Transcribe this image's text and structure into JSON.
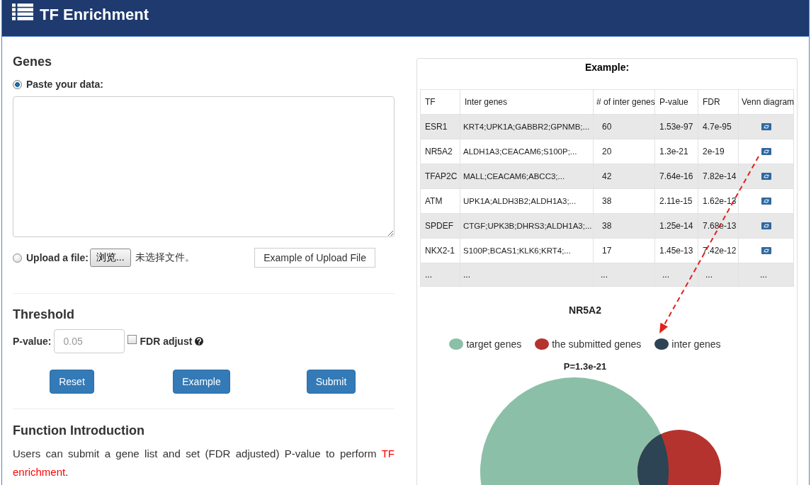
{
  "header": {
    "title": "TF Enrichment"
  },
  "genes": {
    "heading": "Genes",
    "paste_option": {
      "label": "Paste your data:",
      "selected": true
    },
    "upload_option": {
      "label": "Upload a file:",
      "selected": false,
      "browse_button": "浏览...",
      "file_status": "未选择文件。"
    },
    "example_file_button": "Example of Upload File"
  },
  "threshold": {
    "heading": "Threshold",
    "p_value": {
      "label": "P-value:",
      "placeholder": "0.05"
    },
    "fdr_adjust": {
      "label": "FDR adjust",
      "checked": false
    }
  },
  "buttons": [
    "Reset",
    "Example",
    "Submit"
  ],
  "introduction": {
    "heading": "Function Introduction",
    "text": "Users can submit a gene list and set (FDR adjusted) P-value to perform ",
    "highlight": "TF enrichment",
    "text_end": "."
  },
  "example": {
    "title": "Example:",
    "table": {
      "columns": [
        "TF",
        "Inter genes",
        "# of inter genes",
        "P-value",
        "FDR",
        "Venn diagram"
      ],
      "rows": [
        {
          "kind": "result",
          "cells": [
            "ESR1",
            "KRT4;UPK1A;GABBR2;GPNMB;...",
            "60",
            "1.53e-97",
            "4.7e-95"
          ]
        },
        {
          "kind": "result",
          "cells": [
            "NR5A2",
            "ALDH1A3;CEACAM6;S100P;...",
            "20",
            "1.3e-21",
            "2e-19"
          ]
        },
        {
          "kind": "result",
          "cells": [
            "TFAP2C",
            "MALL;CEACAM6;ABCC3;...",
            "42",
            "7.64e-16",
            "7.82e-14"
          ]
        },
        {
          "kind": "result",
          "cells": [
            "ATM",
            "UPK1A;ALDH3B2;ALDH1A3;...",
            "38",
            "2.11e-15",
            "1.62e-13"
          ]
        },
        {
          "kind": "result",
          "cells": [
            "SPDEF",
            "CTGF;UPK3B;DHRS3;ALDH1A3;...",
            "38",
            "1.25e-14",
            "7.68e-13"
          ]
        },
        {
          "kind": "result",
          "cells": [
            "NKX2-1",
            "S100P;BCAS1;KLK6;KRT4;...",
            "17",
            "1.45e-13",
            "7.42e-12"
          ]
        },
        {
          "kind": "ellipsis",
          "cells": [
            "...",
            "...",
            "...",
            "...",
            "...",
            "..."
          ]
        }
      ]
    },
    "venn": {
      "title": "NR5A2",
      "legend": [
        {
          "label": "target genes",
          "color": "#8cbfa8"
        },
        {
          "label": "the submitted genes",
          "color": "#b5332e"
        },
        {
          "label": "inter genes",
          "color": "#2c4453"
        }
      ],
      "p_label": "P=1.3e-21"
    }
  }
}
